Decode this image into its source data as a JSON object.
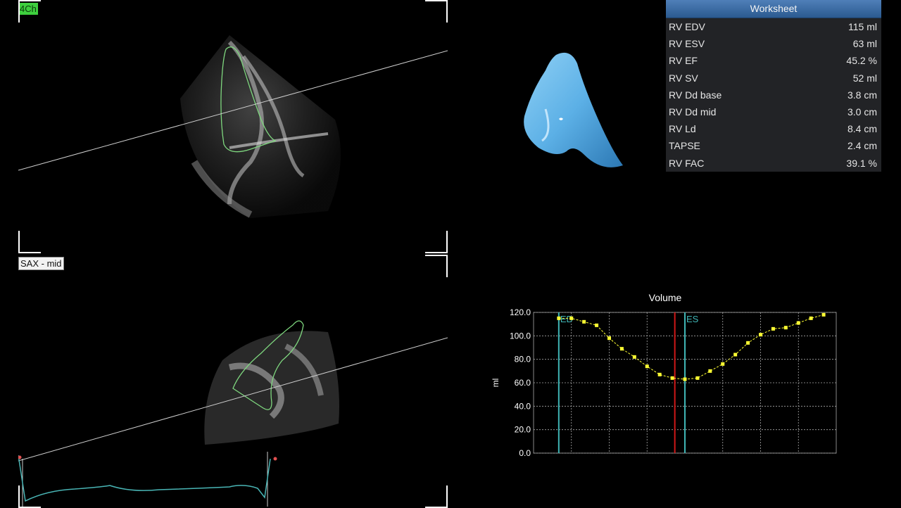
{
  "viewports": {
    "top_label": "4Ch",
    "bottom_label": "SAX - mid"
  },
  "worksheet": {
    "title": "Worksheet",
    "rows": [
      {
        "label": "RV EDV",
        "value": "115 ml"
      },
      {
        "label": "RV ESV",
        "value": "63 ml"
      },
      {
        "label": "RV EF",
        "value": "45.2 %"
      },
      {
        "label": "RV SV",
        "value": "52 ml"
      },
      {
        "label": "RV Dd base",
        "value": "3.8 cm"
      },
      {
        "label": "RV Dd mid",
        "value": "3.0 cm"
      },
      {
        "label": "RV Ld",
        "value": "8.4 cm"
      },
      {
        "label": "TAPSE",
        "value": "2.4 cm"
      },
      {
        "label": "RV FAC",
        "value": "39.1 %"
      }
    ]
  },
  "colors": {
    "curve": "#ffff33",
    "ed_es_markers": "#3fb5b5",
    "cursor": "#d01818",
    "contour": "#7fd87f",
    "model": "#5cb0e6"
  },
  "chart_data": {
    "type": "line",
    "title": "Volume",
    "xlabel": "",
    "ylabel": "ml",
    "ylim": [
      0,
      120
    ],
    "yticks": [
      "0.0",
      "20.0",
      "40.0",
      "60.0",
      "80.0",
      "100.0",
      "120.0"
    ],
    "grid": true,
    "x": [
      0,
      1,
      2,
      3,
      4,
      5,
      6,
      7,
      8,
      9,
      10,
      11,
      12,
      13,
      14,
      15,
      16,
      17,
      18,
      19,
      20,
      21
    ],
    "xlim": [
      -2,
      22
    ],
    "series": [
      {
        "values": [
          115,
          115,
          112,
          109,
          98,
          89,
          82,
          74,
          67,
          64,
          63,
          64,
          70,
          76,
          84,
          94,
          101,
          106,
          107,
          111,
          115,
          118
        ]
      }
    ],
    "markers": [
      {
        "label": "ED",
        "x": 0
      },
      {
        "label": "ES",
        "x": 10
      }
    ],
    "cursor_x": 9.2
  }
}
